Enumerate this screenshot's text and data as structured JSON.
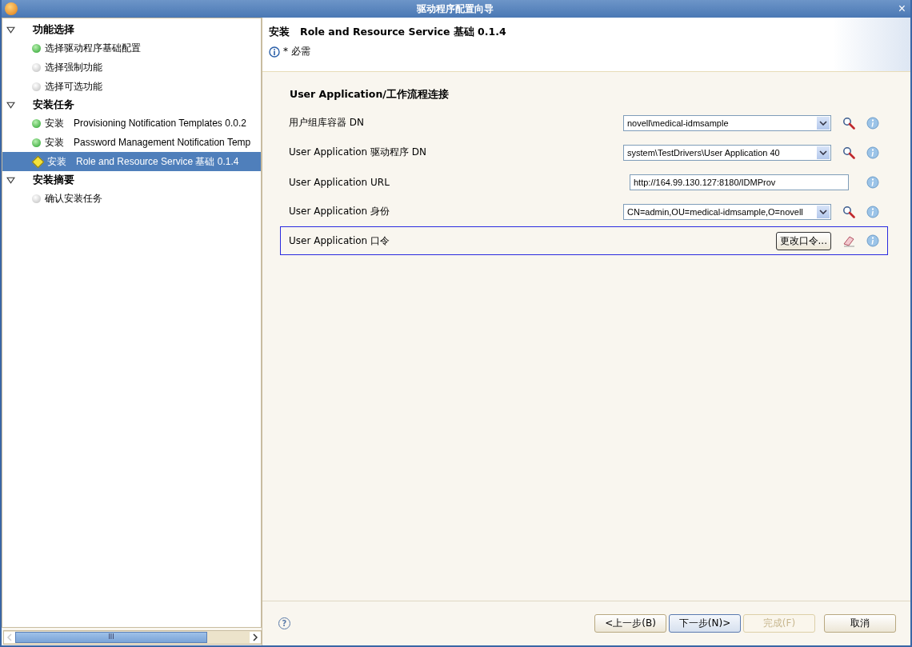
{
  "window": {
    "title": "驱动程序配置向导",
    "close": "×"
  },
  "tree": [
    {
      "label": "功能选择",
      "expanded": true,
      "children": [
        {
          "label": "选择驱动程序基础配置",
          "kind": "done",
          "selected": false
        },
        {
          "label": "选择强制功能",
          "kind": "pending",
          "selected": false
        },
        {
          "label": "选择可选功能",
          "kind": "pending",
          "selected": false
        }
      ]
    },
    {
      "label": "安装任务",
      "expanded": true,
      "children": [
        {
          "prefix": "安装",
          "label": "Provisioning Notification Templates 0.0.2",
          "kind": "done",
          "selected": false
        },
        {
          "prefix": "安装",
          "label": "Password Management Notification Temp",
          "kind": "done",
          "selected": false
        },
        {
          "prefix": "安装",
          "label": "Role and Resource Service 基础 0.1.4",
          "kind": "current",
          "selected": true
        }
      ]
    },
    {
      "label": "安装摘要",
      "expanded": true,
      "children": [
        {
          "label": "确认安装任务",
          "kind": "pending",
          "selected": false
        }
      ]
    }
  ],
  "header": {
    "title": "安装　Role and Resource Service 基础 0.1.4",
    "note": "* 必需"
  },
  "section": {
    "title": "User Application/工作流程连接"
  },
  "rows": [
    {
      "kind": "combo",
      "label": "用户组库容器 DN",
      "value": "novell\\medical-idmsample",
      "focused": false
    },
    {
      "kind": "combo",
      "label": "User Application 驱动程序 DN",
      "value": "system\\TestDrivers\\User Application 40",
      "focused": false
    },
    {
      "kind": "text",
      "label": "User Application URL",
      "value": "http://164.99.130.127:8180/IDMProv",
      "focused": false
    },
    {
      "kind": "combo",
      "label": "User Application 身份",
      "value": "CN=admin,OU=medical-idmsample,O=novell",
      "focused": false
    },
    {
      "kind": "button",
      "label": "User Application 口令",
      "value": "更改口令...",
      "focused": true
    }
  ],
  "footer": {
    "help": "?",
    "buttons": [
      {
        "label": "<上一步(B)",
        "disabled": false,
        "default": false
      },
      {
        "label": "下一步(N)>",
        "disabled": false,
        "default": true
      },
      {
        "label": "完成(F)",
        "disabled": true,
        "default": false
      },
      {
        "label": "取消",
        "disabled": false,
        "default": false
      }
    ]
  },
  "scrollbar": {
    "grip": "III"
  }
}
